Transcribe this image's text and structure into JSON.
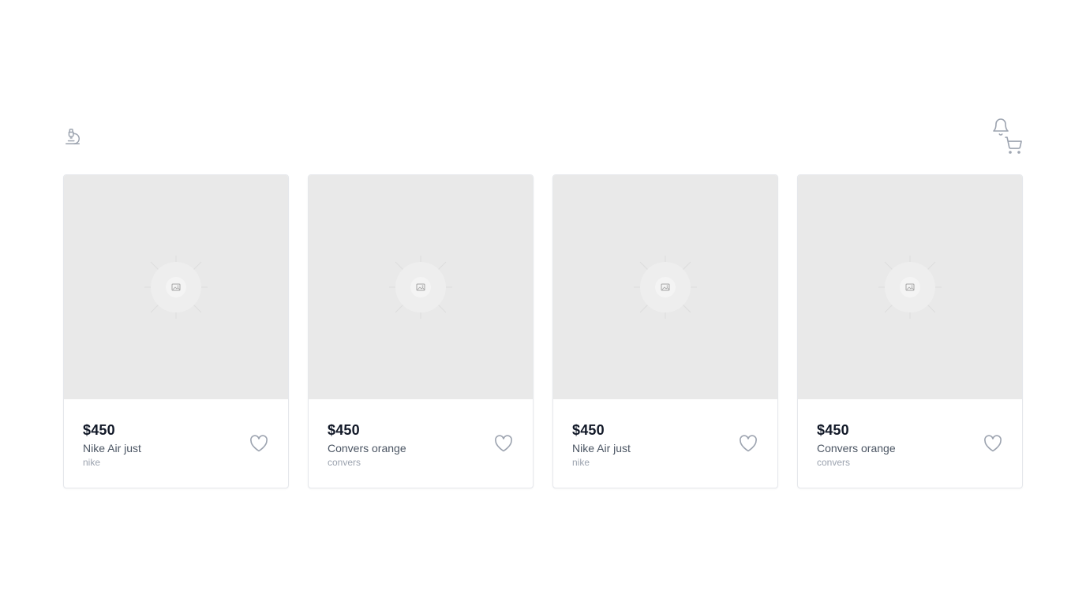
{
  "header": {
    "logo_icon": "microscope-icon",
    "notifications_icon": "bell-icon",
    "cart_icon": "cart-icon"
  },
  "colors": {
    "icon": "#9ca3af",
    "price": "#111827",
    "name": "#4b5563",
    "brand": "#9ca3af",
    "placeholder_bg": "#e9e9e9"
  },
  "products": [
    {
      "price": "$450",
      "name": "Nike Air just",
      "brand": "nike",
      "image_icon": "image-placeholder-icon",
      "favorite_icon": "heart-icon"
    },
    {
      "price": "$450",
      "name": "Convers orange",
      "brand": "convers",
      "image_icon": "image-placeholder-icon",
      "favorite_icon": "heart-icon"
    },
    {
      "price": "$450",
      "name": "Nike Air just",
      "brand": "nike",
      "image_icon": "image-placeholder-icon",
      "favorite_icon": "heart-icon"
    },
    {
      "price": "$450",
      "name": "Convers orange",
      "brand": "convers",
      "image_icon": "image-placeholder-icon",
      "favorite_icon": "heart-icon"
    }
  ]
}
